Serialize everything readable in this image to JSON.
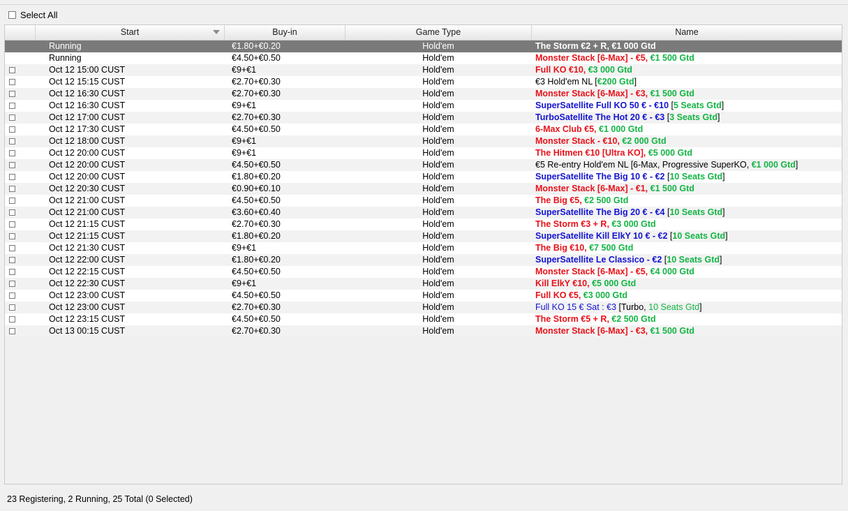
{
  "select_all_label": "Select All",
  "columns": [
    "Start",
    "Buy-in",
    "Game Type",
    "Name"
  ],
  "sort_column": "Start",
  "colors": {
    "red": "#e8121a",
    "green": "#14b545",
    "blue": "#1414d2",
    "selected_row": "#7a7a7a"
  },
  "rows": [
    {
      "start": "Running",
      "buyin": "€1.80+€0.20",
      "game": "Hold'em",
      "checkbox": false,
      "selected": true,
      "name": [
        {
          "t": "The Storm €2 + R, ",
          "s": "w"
        },
        {
          "t": "€1 000 Gtd",
          "s": "w"
        }
      ]
    },
    {
      "start": "Running",
      "buyin": "€4.50+€0.50",
      "game": "Hold'em",
      "checkbox": false,
      "name": [
        {
          "t": "Monster Stack [6-Max] - €5, ",
          "s": "r"
        },
        {
          "t": "€1 500 Gtd",
          "s": "g"
        }
      ]
    },
    {
      "start": "Oct 12  15:00 CUST",
      "buyin": "€9+€1",
      "game": "Hold'em",
      "checkbox": true,
      "name": [
        {
          "t": "Full KO €10, ",
          "s": "r"
        },
        {
          "t": "€3 000 Gtd",
          "s": "g"
        }
      ]
    },
    {
      "start": "Oct 12  15:15 CUST",
      "buyin": "€2.70+€0.30",
      "game": "Hold'em",
      "checkbox": true,
      "name": [
        {
          "t": "€3 Hold'em NL [",
          "s": "k"
        },
        {
          "t": "€200 Gtd",
          "s": "g"
        },
        {
          "t": "]",
          "s": "k"
        }
      ]
    },
    {
      "start": "Oct 12  16:30 CUST",
      "buyin": "€2.70+€0.30",
      "game": "Hold'em",
      "checkbox": true,
      "name": [
        {
          "t": "Monster Stack [6-Max] - €3, ",
          "s": "r"
        },
        {
          "t": "€1 500 Gtd",
          "s": "g"
        }
      ]
    },
    {
      "start": "Oct 12  16:30 CUST",
      "buyin": "€9+€1",
      "game": "Hold'em",
      "checkbox": true,
      "name": [
        {
          "t": "SuperSatellite Full KO 50 € - €10 ",
          "s": "b"
        },
        {
          "t": "[",
          "s": "k"
        },
        {
          "t": "5 Seats Gtd",
          "s": "g"
        },
        {
          "t": "]",
          "s": "k"
        }
      ]
    },
    {
      "start": "Oct 12  17:00 CUST",
      "buyin": "€2.70+€0.30",
      "game": "Hold'em",
      "checkbox": true,
      "name": [
        {
          "t": "TurboSatellite The Hot 20 € - €3 ",
          "s": "b"
        },
        {
          "t": "[",
          "s": "k"
        },
        {
          "t": "3 Seats Gtd",
          "s": "g"
        },
        {
          "t": "]",
          "s": "k"
        }
      ]
    },
    {
      "start": "Oct 12  17:30 CUST",
      "buyin": "€4.50+€0.50",
      "game": "Hold'em",
      "checkbox": true,
      "name": [
        {
          "t": "6-Max Club €5, ",
          "s": "r"
        },
        {
          "t": "€1 000 Gtd",
          "s": "g"
        }
      ]
    },
    {
      "start": "Oct 12  18:00 CUST",
      "buyin": "€9+€1",
      "game": "Hold'em",
      "checkbox": true,
      "name": [
        {
          "t": "Monster Stack - €10, ",
          "s": "r"
        },
        {
          "t": "€2 000 Gtd",
          "s": "g"
        }
      ]
    },
    {
      "start": "Oct 12  20:00 CUST",
      "buyin": "€9+€1",
      "game": "Hold'em",
      "checkbox": true,
      "name": [
        {
          "t": "The Hitmen €10 [Ultra KO], ",
          "s": "r"
        },
        {
          "t": "€5 000 Gtd",
          "s": "g"
        }
      ]
    },
    {
      "start": "Oct 12  20:00 CUST",
      "buyin": "€4.50+€0.50",
      "game": "Hold'em",
      "checkbox": true,
      "name": [
        {
          "t": "€5 Re-entry Hold'em NL [6-Max, Progressive SuperKO, ",
          "s": "k"
        },
        {
          "t": "€1 000 Gtd",
          "s": "g"
        },
        {
          "t": "]",
          "s": "k"
        }
      ]
    },
    {
      "start": "Oct 12  20:00 CUST",
      "buyin": "€1.80+€0.20",
      "game": "Hold'em",
      "checkbox": true,
      "name": [
        {
          "t": "SuperSatellite The Big 10 € - €2 ",
          "s": "b"
        },
        {
          "t": "[",
          "s": "k"
        },
        {
          "t": "10 Seats Gtd",
          "s": "g"
        },
        {
          "t": "]",
          "s": "k"
        }
      ]
    },
    {
      "start": "Oct 12  20:30 CUST",
      "buyin": "€0.90+€0.10",
      "game": "Hold'em",
      "checkbox": true,
      "name": [
        {
          "t": "Monster Stack [6-Max] - €1, ",
          "s": "r"
        },
        {
          "t": "€1 500 Gtd",
          "s": "g"
        }
      ]
    },
    {
      "start": "Oct 12  21:00 CUST",
      "buyin": "€4.50+€0.50",
      "game": "Hold'em",
      "checkbox": true,
      "name": [
        {
          "t": "The Big €5, ",
          "s": "r"
        },
        {
          "t": "€2 500 Gtd",
          "s": "g"
        }
      ]
    },
    {
      "start": "Oct 12  21:00 CUST",
      "buyin": "€3.60+€0.40",
      "game": "Hold'em",
      "checkbox": true,
      "name": [
        {
          "t": "SuperSatellite The Big 20 € - €4 ",
          "s": "b"
        },
        {
          "t": "[",
          "s": "k"
        },
        {
          "t": "10 Seats Gtd",
          "s": "g"
        },
        {
          "t": "]",
          "s": "k"
        }
      ]
    },
    {
      "start": "Oct 12  21:15 CUST",
      "buyin": "€2.70+€0.30",
      "game": "Hold'em",
      "checkbox": true,
      "name": [
        {
          "t": "The Storm €3 + R, ",
          "s": "r"
        },
        {
          "t": "€3 000 Gtd",
          "s": "g"
        }
      ]
    },
    {
      "start": "Oct 12  21:15 CUST",
      "buyin": "€1.80+€0.20",
      "game": "Hold'em",
      "checkbox": true,
      "name": [
        {
          "t": "SuperSatellite Kill ElkY 10 € - €2 ",
          "s": "b"
        },
        {
          "t": "[",
          "s": "k"
        },
        {
          "t": "10 Seats Gtd",
          "s": "g"
        },
        {
          "t": "]",
          "s": "k"
        }
      ]
    },
    {
      "start": "Oct 12  21:30 CUST",
      "buyin": "€9+€1",
      "game": "Hold'em",
      "checkbox": true,
      "name": [
        {
          "t": "The Big €10, ",
          "s": "r"
        },
        {
          "t": "€7 500 Gtd",
          "s": "g"
        }
      ]
    },
    {
      "start": "Oct 12  22:00 CUST",
      "buyin": "€1.80+€0.20",
      "game": "Hold'em",
      "checkbox": true,
      "name": [
        {
          "t": "SuperSatellite Le Classico - €2 ",
          "s": "b"
        },
        {
          "t": "[",
          "s": "k"
        },
        {
          "t": "10 Seats Gtd",
          "s": "g"
        },
        {
          "t": "]",
          "s": "k"
        }
      ]
    },
    {
      "start": "Oct 12  22:15 CUST",
      "buyin": "€4.50+€0.50",
      "game": "Hold'em",
      "checkbox": true,
      "name": [
        {
          "t": "Monster Stack [6-Max] - €5, ",
          "s": "r"
        },
        {
          "t": "€4 000 Gtd",
          "s": "g"
        }
      ]
    },
    {
      "start": "Oct 12  22:30 CUST",
      "buyin": "€9+€1",
      "game": "Hold'em",
      "checkbox": true,
      "name": [
        {
          "t": "Kill ElkY €10, ",
          "s": "r"
        },
        {
          "t": "€5 000 Gtd",
          "s": "g"
        }
      ]
    },
    {
      "start": "Oct 12  23:00 CUST",
      "buyin": "€4.50+€0.50",
      "game": "Hold'em",
      "checkbox": true,
      "name": [
        {
          "t": "Full KO €5, ",
          "s": "r"
        },
        {
          "t": "€3 000 Gtd",
          "s": "g"
        }
      ]
    },
    {
      "start": "Oct 12  23:00 CUST",
      "buyin": "€2.70+€0.30",
      "game": "Hold'em",
      "checkbox": true,
      "name": [
        {
          "t": "Full KO 15 € Sat : €3 ",
          "s": "bl"
        },
        {
          "t": " [Turbo, ",
          "s": "k"
        },
        {
          "t": "10 Seats Gtd",
          "s": "gl"
        },
        {
          "t": "]",
          "s": "k"
        }
      ]
    },
    {
      "start": "Oct 12  23:15 CUST",
      "buyin": "€4.50+€0.50",
      "game": "Hold'em",
      "checkbox": true,
      "name": [
        {
          "t": "The Storm €5 + R, ",
          "s": "r"
        },
        {
          "t": "€2 500 Gtd",
          "s": "g"
        }
      ]
    },
    {
      "start": "Oct 13  00:15 CUST",
      "buyin": "€2.70+€0.30",
      "game": "Hold'em",
      "checkbox": true,
      "name": [
        {
          "t": "Monster Stack [6-Max] - €3, ",
          "s": "r"
        },
        {
          "t": "€1 500 Gtd",
          "s": "g"
        }
      ]
    }
  ],
  "status_text": "23 Registering, 2 Running, 25 Total (0 Selected)"
}
